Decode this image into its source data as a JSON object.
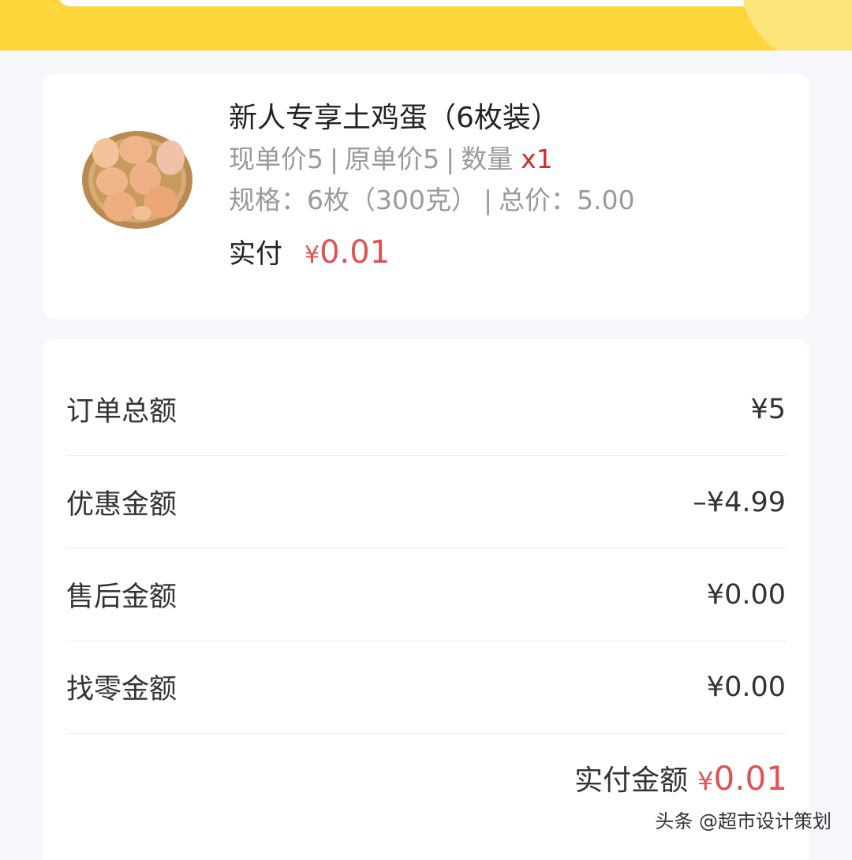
{
  "product": {
    "title": "新人专享土鸡蛋（6枚装）",
    "unit_price_label": "现单价5",
    "original_price_label": "原单价5",
    "quantity_label": "数量",
    "quantity_value": "x1",
    "spec_label": "规格：6枚（300克）",
    "total_label": "总价：5.00",
    "paid_label": "实付",
    "paid_currency": "¥",
    "paid_amount": "0.01",
    "image_icon": "egg-basket-icon"
  },
  "summary": {
    "rows": [
      {
        "label": "订单总额",
        "value": "¥5"
      },
      {
        "label": "优惠金额",
        "value": "–¥4.99"
      },
      {
        "label": "售后金额",
        "value": "¥0.00"
      },
      {
        "label": "找零金额",
        "value": "¥0.00"
      }
    ],
    "total_label": "实付金额",
    "total_currency": "¥",
    "total_amount": "0.01"
  },
  "watermark": "头条 @超市设计策划",
  "colors": {
    "banner": "#fdd63c",
    "accent_red": "#e05353",
    "background": "#f6f7fb"
  }
}
